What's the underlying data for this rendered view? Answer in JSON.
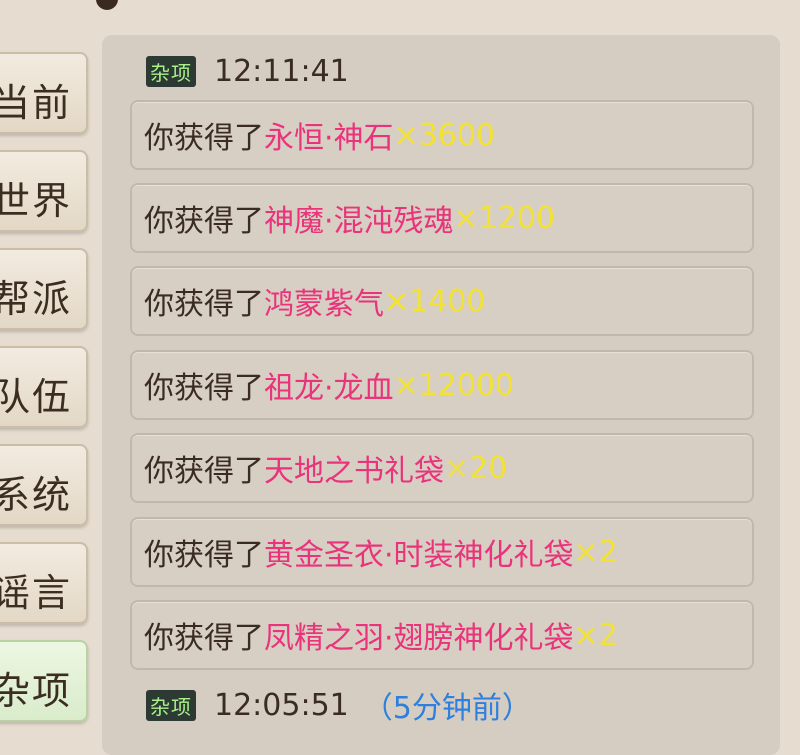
{
  "top_hint": "…",
  "tabs": [
    {
      "label": "当前"
    },
    {
      "label": "世界"
    },
    {
      "label": "帮派"
    },
    {
      "label": "队伍"
    },
    {
      "label": "系统"
    },
    {
      "label": "谣言"
    },
    {
      "label": "杂项"
    }
  ],
  "active_tab": "杂项",
  "groups": [
    {
      "badge": "杂项",
      "time": "12:11:41",
      "ago": "",
      "messages": [
        {
          "prefix": "你获得了",
          "item": "永恒·神石",
          "qty": "×3600"
        },
        {
          "prefix": "你获得了",
          "item": "神魔·混沌残魂",
          "qty": "×1200"
        },
        {
          "prefix": "你获得了",
          "item": "鸿蒙紫气",
          "qty": "×1400"
        },
        {
          "prefix": "你获得了",
          "item": "祖龙·龙血",
          "qty": "×12000"
        },
        {
          "prefix": "你获得了",
          "item": "天地之书礼袋",
          "qty": "×20"
        },
        {
          "prefix": "你获得了",
          "item": "黄金圣衣·时装神化礼袋",
          "qty": "×2"
        },
        {
          "prefix": "你获得了",
          "item": "凤精之羽·翅膀神化礼袋",
          "qty": "×2"
        }
      ]
    },
    {
      "badge": "杂项",
      "time": "12:05:51",
      "ago": "（5分钟前）",
      "messages": []
    }
  ],
  "colors": {
    "item": "#e9337a",
    "qty": "#f2e233",
    "ago": "#2f7fdc",
    "badge_text": "#a9f08a"
  }
}
